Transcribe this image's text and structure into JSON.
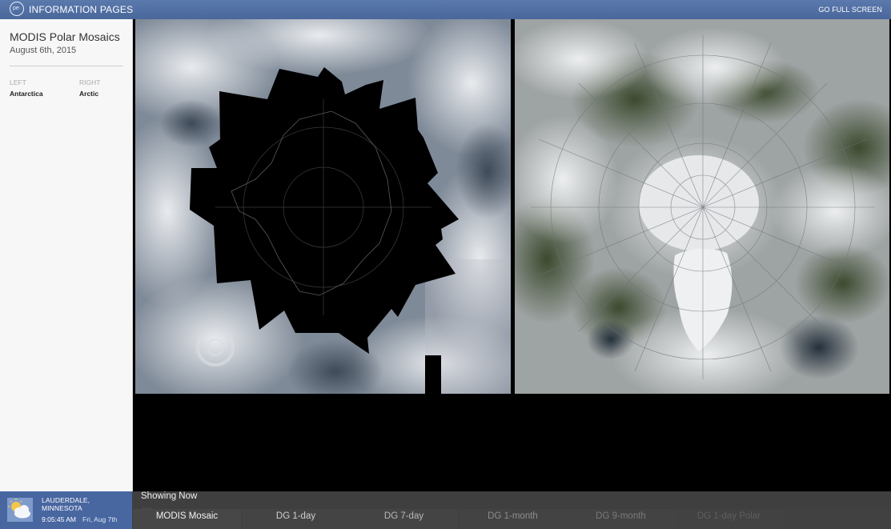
{
  "header": {
    "logo_text": "pe·",
    "title": "INFORMATION PAGES",
    "fullscreen_label": "GO FULL SCREEN"
  },
  "sidebar": {
    "title": "MODIS Polar Mosaics",
    "date": "August 6th, 2015",
    "left_label": "LEFT",
    "left_value": "Antarctica",
    "right_label": "RIGHT",
    "right_value": "Arctic"
  },
  "images": {
    "left": {
      "name": "Antarctica mosaic"
    },
    "right": {
      "name": "Arctic mosaic"
    }
  },
  "footer": {
    "weather": {
      "icon": "partly-cloudy-icon",
      "location": "LAUDERDALE, MINNESOTA",
      "time": "9:05:45 AM",
      "date": "Fri, Aug 7th"
    },
    "showing_label": "Showing Now",
    "tabs": [
      {
        "label": "MODIS Mosaic",
        "state": "active"
      },
      {
        "label": "DG 1-day",
        "state": "normal"
      },
      {
        "label": "DG 7-day",
        "state": "normal"
      },
      {
        "label": "DG 1-month",
        "state": "dim"
      },
      {
        "label": "DG 9-month",
        "state": "dim"
      },
      {
        "label": "DG 1-day Polar",
        "state": "dimmer"
      },
      {
        "label": "",
        "state": "faint"
      }
    ]
  },
  "colors": {
    "header_bg": "#4f6ea3",
    "weather_bg": "#4866a0",
    "footer_bg": "#3f3f3f",
    "sidebar_bg": "#f7f7f7"
  }
}
